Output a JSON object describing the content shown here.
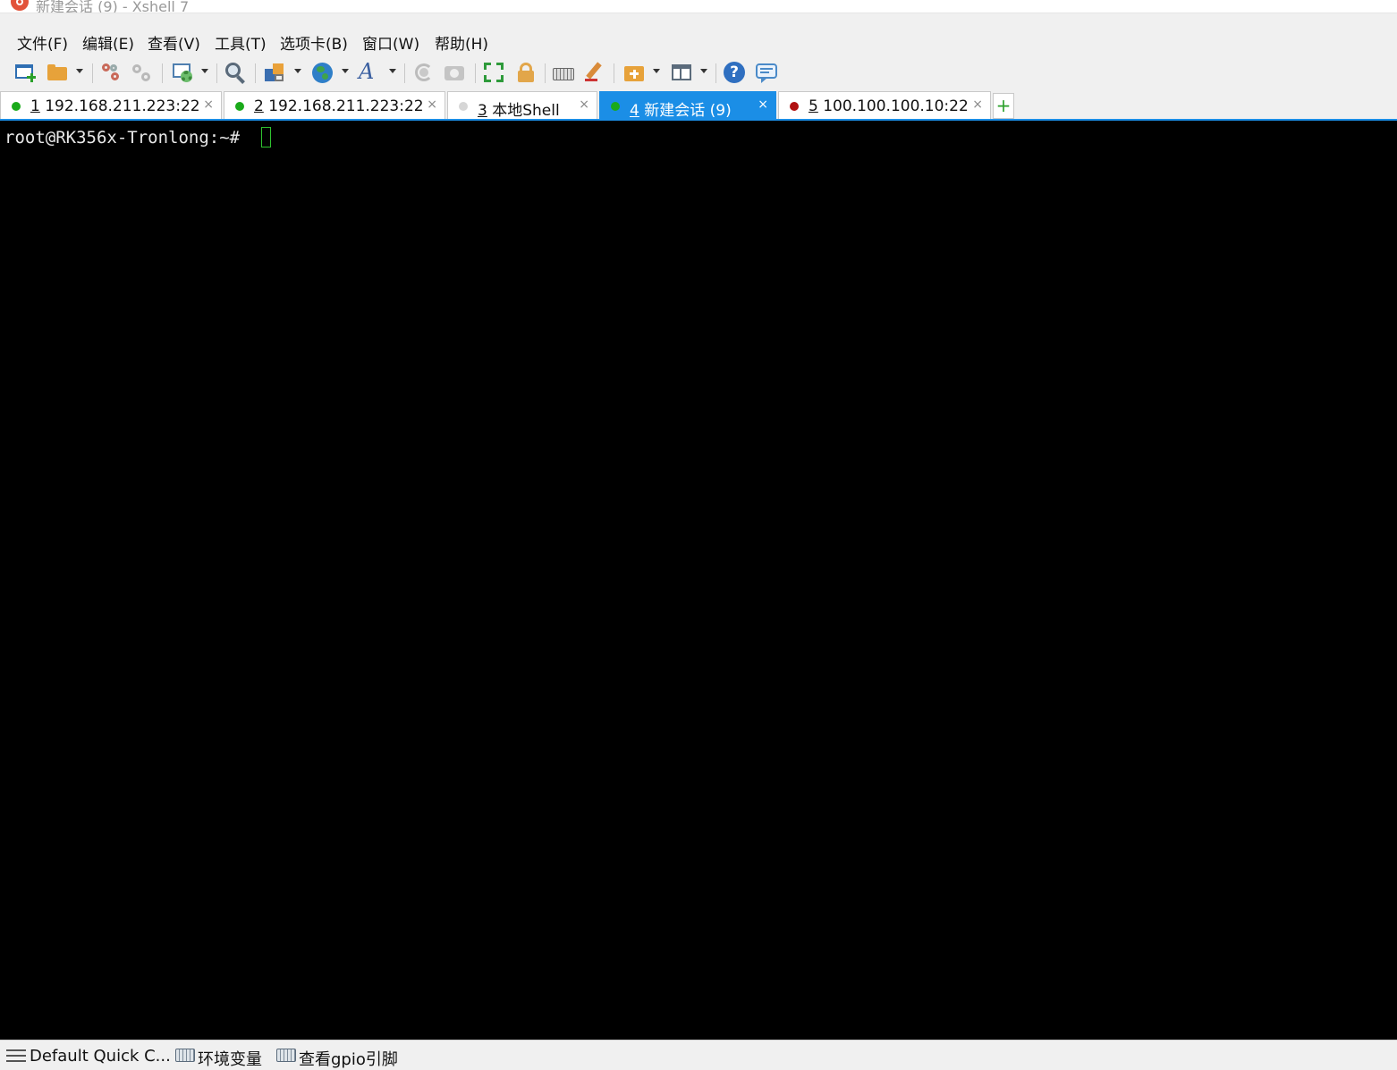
{
  "window": {
    "title": "新建会话 (9) - Xshell 7"
  },
  "menu": {
    "items": [
      "文件(F)",
      "编辑(E)",
      "查看(V)",
      "工具(T)",
      "选项卡(B)",
      "窗口(W)",
      "帮助(H)"
    ]
  },
  "toolbar": {
    "icons": [
      "new-session-icon",
      "open-folder-icon",
      "connect-icon",
      "disconnect-icon",
      "properties-icon",
      "find-icon",
      "transfer-icon",
      "globe-icon",
      "font-icon",
      "reconnect-icon",
      "screenshot-icon",
      "fullscreen-icon",
      "lock-icon",
      "keyboard-icon",
      "highlight-icon",
      "add-to-session-icon",
      "layout-icon",
      "help-icon",
      "chat-icon"
    ]
  },
  "tabs": [
    {
      "num": "1",
      "label": "192.168.211.223:22",
      "status": "connected",
      "color": "#1aaa1a",
      "active": false
    },
    {
      "num": "2",
      "label": "192.168.211.223:22",
      "status": "connected",
      "color": "#1aaa1a",
      "active": false
    },
    {
      "num": "3",
      "label": "本地Shell",
      "status": "local",
      "color": "#d6d6d6",
      "active": false
    },
    {
      "num": "4",
      "label": "新建会话 (9)",
      "status": "connected",
      "color": "#1aaa1a",
      "active": true
    },
    {
      "num": "5",
      "label": "100.100.100.10:22",
      "status": "disconnected",
      "color": "#b01010",
      "active": false
    }
  ],
  "tab_close_glyph": "×",
  "add_tab_glyph": "+",
  "terminal": {
    "prompt": "root@RK356x-Tronlong:~# ",
    "background": "#000000",
    "foreground": "#e8e8e8",
    "cursor_color": "#2fc22f"
  },
  "quick_commands": {
    "group": "Default Quick C...",
    "buttons": [
      "环境变量",
      "查看gpio引脚"
    ]
  }
}
